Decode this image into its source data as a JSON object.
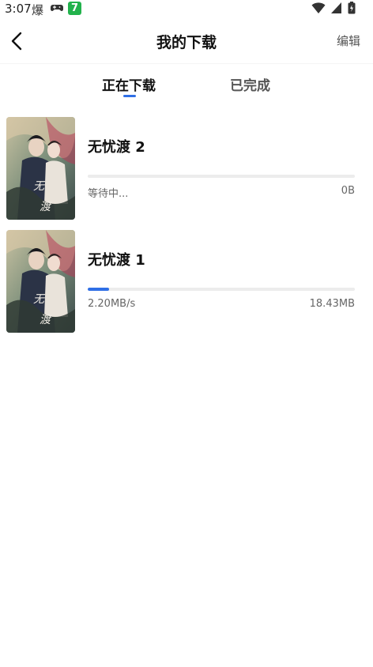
{
  "status_bar": {
    "time": "3:07",
    "flame_glyph": "爆",
    "app_badge": "7",
    "icons": [
      "gamepad-icon",
      "wifi-icon",
      "signal-icon",
      "battery-icon"
    ]
  },
  "header": {
    "title": "我的下载",
    "edit_label": "编辑",
    "back_icon": "chevron-left-icon"
  },
  "tabs": {
    "items": [
      {
        "label": "正在下载",
        "active": true
      },
      {
        "label": "已完成",
        "active": false
      }
    ],
    "accent_color": "#2f6fe6"
  },
  "downloads": [
    {
      "title": "无忧渡 2",
      "progress": 0.0,
      "status": "等待中...",
      "size": "0B"
    },
    {
      "title": "无忧渡 1",
      "progress": 0.08,
      "status": "2.20MB/s",
      "size": "18.43MB"
    }
  ]
}
